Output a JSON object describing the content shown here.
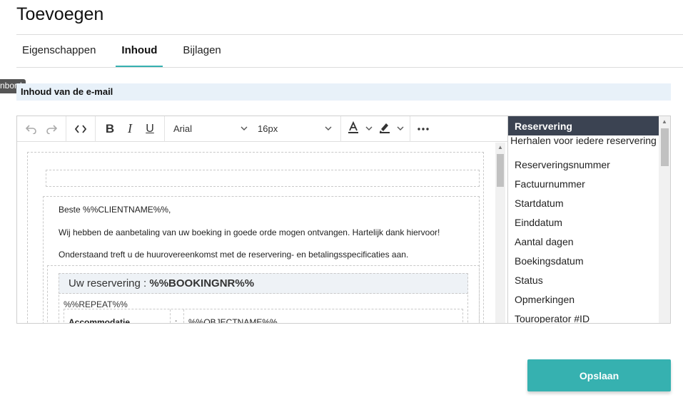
{
  "page": {
    "title": "Toevoegen"
  },
  "tabs": [
    {
      "label": "Eigenschappen"
    },
    {
      "label": "Inhoud"
    },
    {
      "label": "Bijlagen"
    }
  ],
  "tooltip": {
    "text": "nbord"
  },
  "section": {
    "title": "Inhoud van de e-mail"
  },
  "toolbar": {
    "font_family": "Arial",
    "font_size": "16px"
  },
  "email": {
    "greeting": "Beste %%CLIENTNAME%%,",
    "line1": "Wij hebben de aanbetaling van uw boeking in goede orde mogen ontvangen. Hartelijk dank hiervoor!",
    "line2": "Onderstaand treft u de huurovereenkomst met de reservering- en betalingsspecificaties aan.",
    "reservation_label": "Uw reservering :",
    "reservation_value": "%%BOOKINGNR%%",
    "repeat_tag": "%%REPEAT%%",
    "row_label": "Accommodatie",
    "row_sep": ":",
    "row_value": "%%OBJECTNAME%%"
  },
  "fields": {
    "header": "Reservering",
    "repeat_label": "Herhalen voor iedere reservering",
    "items": [
      "Reserveringsnummer",
      "Factuurnummer",
      "Startdatum",
      "Einddatum",
      "Aantal dagen",
      "Boekingsdatum",
      "Status",
      "Opmerkingen",
      "Touroperator #ID"
    ]
  },
  "actions": {
    "save_label": "Opslaan"
  },
  "colors": {
    "accent": "#36b1b0",
    "field_header": "#3b4352",
    "section_bg": "#e8f1f9"
  }
}
